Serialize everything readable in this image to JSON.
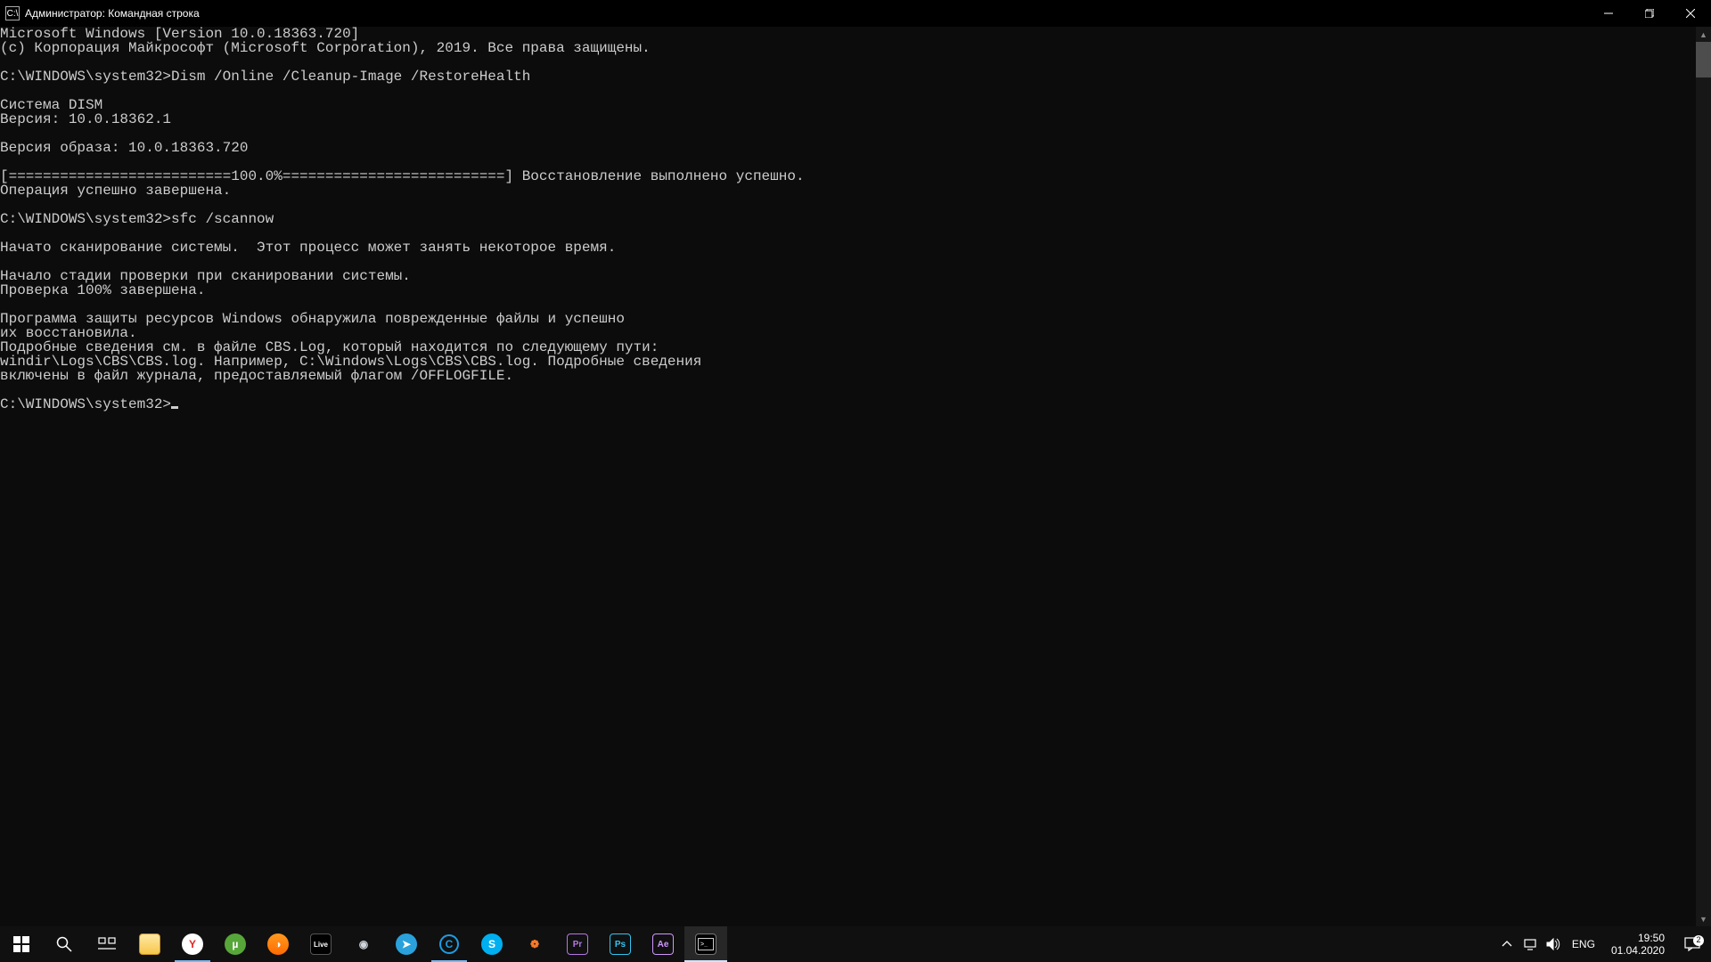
{
  "window": {
    "icon_abbrev": "C:\\",
    "title": "Администратор: Командная строка"
  },
  "terminal": {
    "lines": [
      "Microsoft Windows [Version 10.0.18363.720]",
      "(c) Корпорация Майкрософт (Microsoft Corporation), 2019. Все права защищены.",
      "",
      "C:\\WINDOWS\\system32>Dism /Online /Cleanup-Image /RestoreHealth",
      "",
      "Cистема DISM",
      "Версия: 10.0.18362.1",
      "",
      "Версия образа: 10.0.18363.720",
      "",
      "[==========================100.0%==========================] Восстановление выполнено успешно.",
      "Операция успешно завершена.",
      "",
      "C:\\WINDOWS\\system32>sfc /scannow",
      "",
      "Начато сканирование системы.  Этот процесс может занять некоторое время.",
      "",
      "Начало стадии проверки при сканировании системы.",
      "Проверка 100% завершена.",
      "",
      "Программа защиты ресурсов Windows обнаружила поврежденные файлы и успешно",
      "их восстановила.",
      "Подробные сведения см. в файле CBS.Log, который находится по следующему пути:",
      "windir\\Logs\\CBS\\CBS.log. Например, C:\\Windows\\Logs\\CBS\\CBS.log. Подробные сведения",
      "включены в файл журнала, предоставляемый флагом /OFFLOGFILE.",
      ""
    ],
    "prompt": "C:\\WINDOWS\\system32>"
  },
  "tray": {
    "lang": "ENG",
    "time": "19:50",
    "date": "01.04.2020",
    "notifications": "2"
  },
  "taskbar_icons": {
    "yandex": "Y",
    "utor": "µ",
    "daemon": "◑",
    "ableton": "Live",
    "steam": "◉",
    "telegram": "➤",
    "circle": "C",
    "skype": "S",
    "blender": "❁",
    "pr": "Pr",
    "ps": "Ps",
    "ae": "Ae",
    "cmd": "▭"
  }
}
